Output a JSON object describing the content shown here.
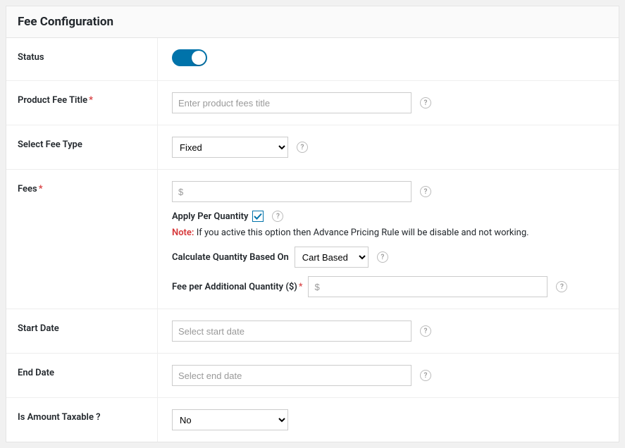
{
  "header": {
    "title": "Fee Configuration"
  },
  "status": {
    "label": "Status",
    "enabled": true
  },
  "title_field": {
    "label": "Product Fee Title",
    "required": "*",
    "placeholder": "Enter product fees title"
  },
  "fee_type": {
    "label": "Select Fee Type",
    "value": "Fixed"
  },
  "fees": {
    "label": "Fees",
    "required": "*",
    "placeholder": "$",
    "apply_per_qty_label": "Apply Per Quantity",
    "note_label": "Note:",
    "note_text": " If you active this option then Advance Pricing Rule will be disable and not working.",
    "calc_label": "Calculate Quantity Based On",
    "calc_value": "Cart Based",
    "per_additional_label": "Fee per Additional Quantity ($)",
    "per_additional_required": "*",
    "per_additional_placeholder": "$"
  },
  "start_date": {
    "label": "Start Date",
    "placeholder": "Select start date"
  },
  "end_date": {
    "label": "End Date",
    "placeholder": "Select end date"
  },
  "taxable": {
    "label": "Is Amount Taxable ?",
    "value": "No"
  }
}
